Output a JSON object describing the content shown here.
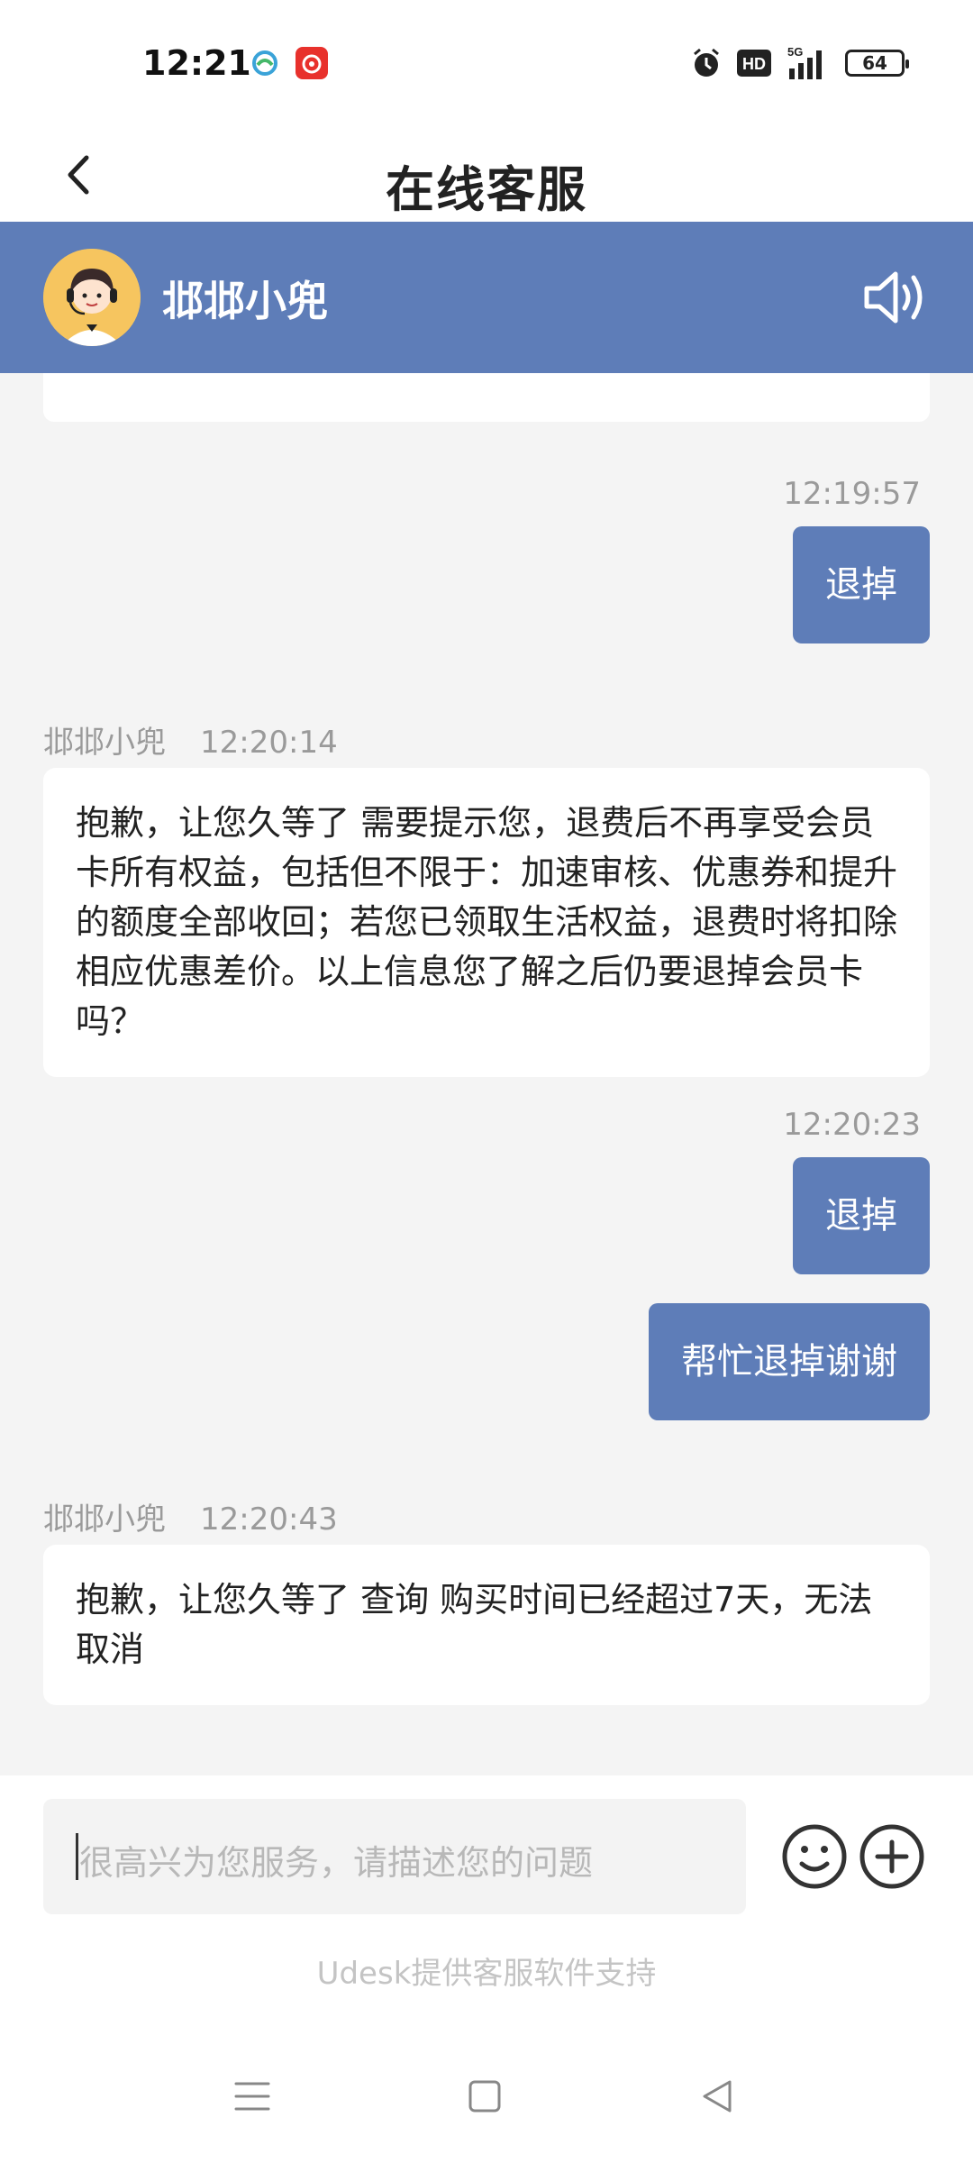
{
  "status_bar": {
    "time": "12:21",
    "net_label": "5G",
    "hd_label": "HD",
    "battery": "64"
  },
  "header": {
    "title": "在线客服"
  },
  "agent": {
    "name": "邶邶小兜"
  },
  "messages": [
    {
      "side": "right",
      "time": "12:19:57",
      "text": "退掉"
    },
    {
      "side": "left",
      "sender": "邶邶小兜",
      "time": "12:20:14",
      "text": "抱歉，让您久等了 需要提示您，退费后不再享受会员卡所有权益，包括但不限于：加速审核、优惠券和提升的额度全部收回；若您已领取生活权益，退费时将扣除相应优惠差价。以上信息您了解之后仍要退掉会员卡吗？"
    },
    {
      "side": "right",
      "time": "12:20:23",
      "text": "退掉"
    },
    {
      "side": "right",
      "text": "帮忙退掉谢谢"
    },
    {
      "side": "left",
      "sender": "邶邶小兜",
      "time": "12:20:43",
      "text": "抱歉，让您久等了 查询 购买时间已经超过7天，无法取消"
    }
  ],
  "input": {
    "placeholder": "很高兴为您服务，请描述您的问题"
  },
  "footer": {
    "powered_by": "Udesk提供客服软件支持"
  },
  "colors": {
    "accent": "#5e7db8",
    "background": "#f4f4f4"
  }
}
